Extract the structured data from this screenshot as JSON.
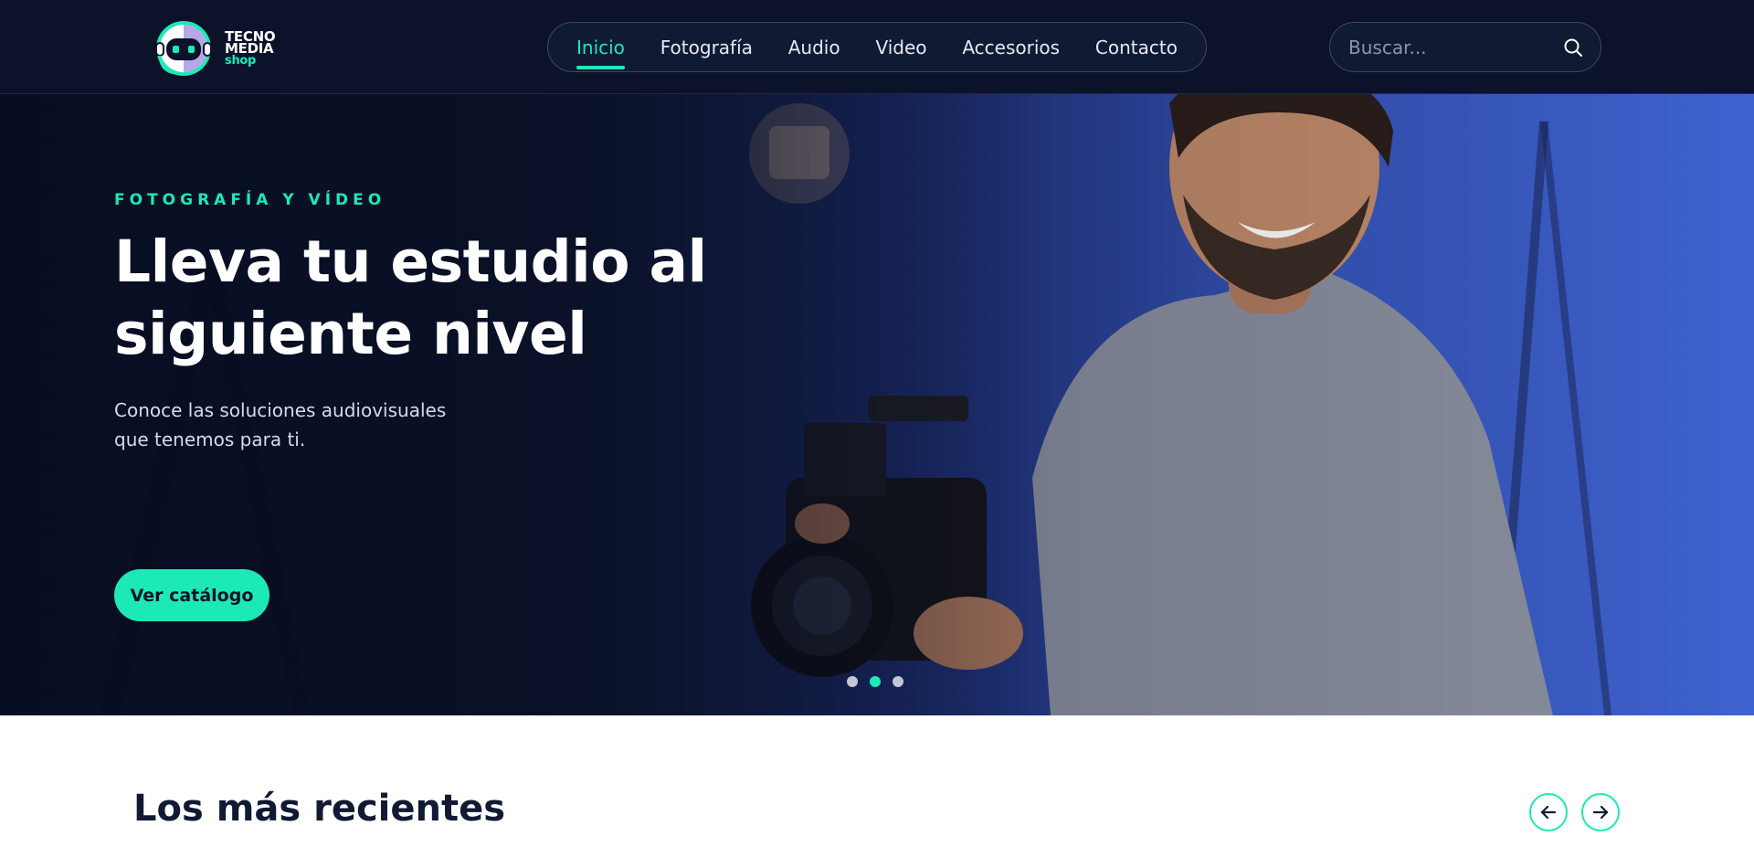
{
  "brand": {
    "line1": "TECNO",
    "line2": "MEDIA",
    "line3": "shop",
    "accent_color": "#1de9b6",
    "dark_color": "#0b1229"
  },
  "nav": {
    "items": [
      {
        "label": "Inicio",
        "active": true
      },
      {
        "label": "Fotografía",
        "active": false
      },
      {
        "label": "Audio",
        "active": false
      },
      {
        "label": "Video",
        "active": false
      },
      {
        "label": "Accesorios",
        "active": false
      },
      {
        "label": "Contacto",
        "active": false
      }
    ]
  },
  "search": {
    "placeholder": "Buscar...",
    "icon": "search-icon"
  },
  "hero": {
    "eyebrow": "FOTOGRAFÍA Y VÍDEO",
    "title": "Lleva tu estudio al siguiente nivel",
    "subtitle": "Conoce las soluciones audiovisuales que tenemos para ti.",
    "cta_label": "Ver catálogo",
    "slides_total": 3,
    "active_slide": 2
  },
  "recent": {
    "title": "Los más recientes",
    "prev_icon": "arrow-left-icon",
    "next_icon": "arrow-right-icon"
  }
}
